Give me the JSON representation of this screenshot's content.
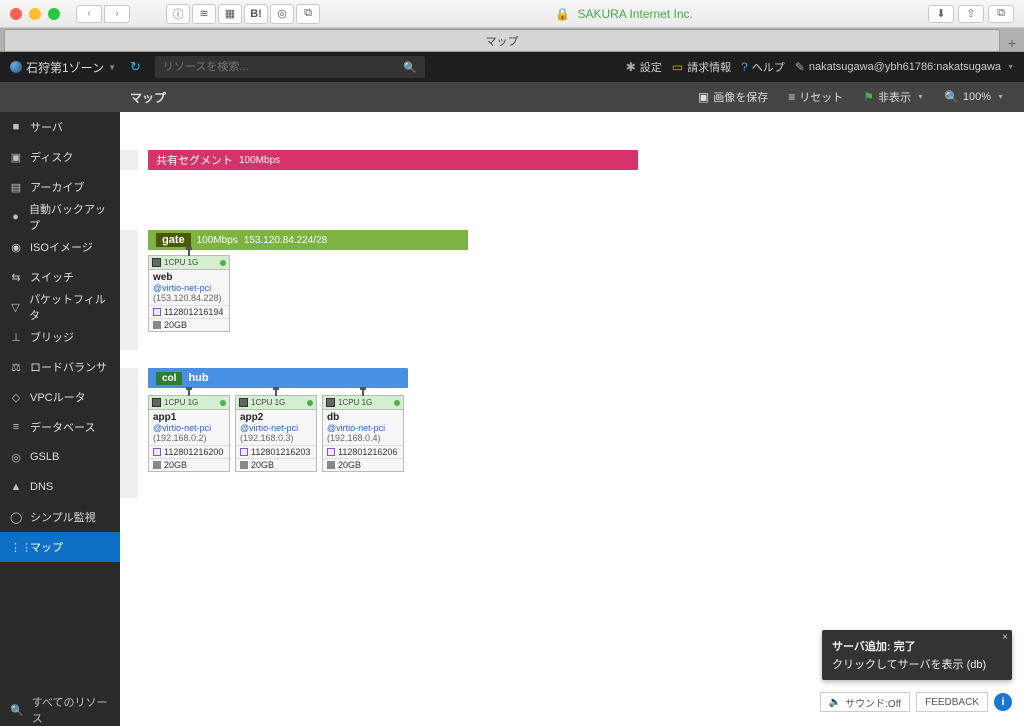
{
  "browser": {
    "address": "SAKURA Internet Inc.",
    "tab_title": "マップ"
  },
  "topbar": {
    "zone": "石狩第1ゾーン",
    "search_placeholder": "リソースを検索...",
    "settings": "設定",
    "billing": "請求情報",
    "help": "ヘルプ",
    "user": "nakatsugawa@ybh61786:nakatsugawa"
  },
  "toolbar": {
    "title": "マップ",
    "save_image": "画像を保存",
    "reset": "リセット",
    "hide": "非表示",
    "zoom": "100%"
  },
  "sidebar": {
    "items": [
      {
        "label": "サーバ",
        "icon": "■"
      },
      {
        "label": "ディスク",
        "icon": "▣"
      },
      {
        "label": "アーカイブ",
        "icon": "▤"
      },
      {
        "label": "自動バックアップ",
        "icon": "●"
      },
      {
        "label": "ISOイメージ",
        "icon": "◉"
      },
      {
        "label": "スイッチ",
        "icon": "⇆"
      },
      {
        "label": "パケットフィルタ",
        "icon": "▽"
      },
      {
        "label": "ブリッジ",
        "icon": "⊥"
      },
      {
        "label": "ロードバランサ",
        "icon": "⚖"
      },
      {
        "label": "VPCルータ",
        "icon": "◇"
      },
      {
        "label": "データベース",
        "icon": "≡"
      },
      {
        "label": "GSLB",
        "icon": "◎"
      },
      {
        "label": "DNS",
        "icon": "▲"
      },
      {
        "label": "シンプル監視",
        "icon": "◯"
      },
      {
        "label": "マップ",
        "icon": "⋮⋮"
      }
    ],
    "footer": "すべてのリソース"
  },
  "segments": {
    "shared": {
      "label": "共有セグメント",
      "speed": "100Mbps"
    },
    "gate": {
      "label": "gate",
      "speed": "100Mbps",
      "cidr": "153.120.84.224/28"
    },
    "hub": {
      "badge": "col",
      "label": "hub"
    }
  },
  "servers": {
    "web": {
      "spec": "1CPU 1G",
      "name": "web",
      "net": "@virtio-net-pci",
      "ip": "(153.120.84.228)",
      "disk_id": "112801216194",
      "size": "20GB"
    },
    "app1": {
      "spec": "1CPU 1G",
      "name": "app1",
      "net": "@virtio-net-pci",
      "ip": "(192.168.0.2)",
      "disk_id": "112801216200",
      "size": "20GB"
    },
    "app2": {
      "spec": "1CPU 1G",
      "name": "app2",
      "net": "@virtio-net-pci",
      "ip": "(192.168.0.3)",
      "disk_id": "112801216203",
      "size": "20GB"
    },
    "db": {
      "spec": "1CPU 1G",
      "name": "db",
      "net": "@virtio-net-pci",
      "ip": "(192.168.0.4)",
      "disk_id": "112801216206",
      "size": "20GB"
    }
  },
  "toast": {
    "title": "サーバ追加: 完了",
    "body": "クリックしてサーバを表示 (db)"
  },
  "bottom": {
    "sound": "サウンド:Off",
    "feedback": "FEEDBACK"
  }
}
